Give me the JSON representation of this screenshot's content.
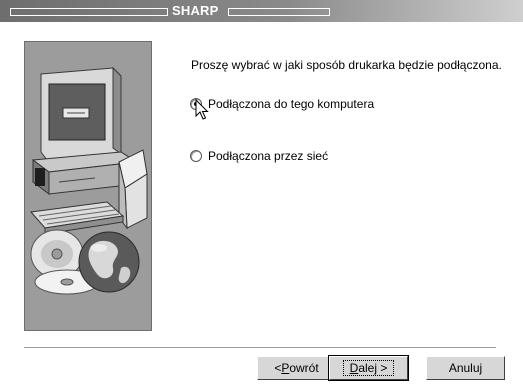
{
  "window": {
    "title": "SHARP"
  },
  "content": {
    "prompt": "Proszę wybrać w jaki sposób drukarka będzie podłączona.",
    "options": [
      {
        "label": "Podłączona do tego komputera",
        "selected": true
      },
      {
        "label": "Podłączona przez sieć",
        "selected": false
      }
    ]
  },
  "buttons": {
    "back": {
      "prefix": "< ",
      "key": "P",
      "rest": "owrót"
    },
    "next": {
      "key": "D",
      "rest": "alej",
      "suffix": " >"
    },
    "cancel": "Anuluj"
  },
  "icons": {
    "illustration": "computer-cd-globe-illustration",
    "cursor": "mouse-pointer-icon"
  }
}
